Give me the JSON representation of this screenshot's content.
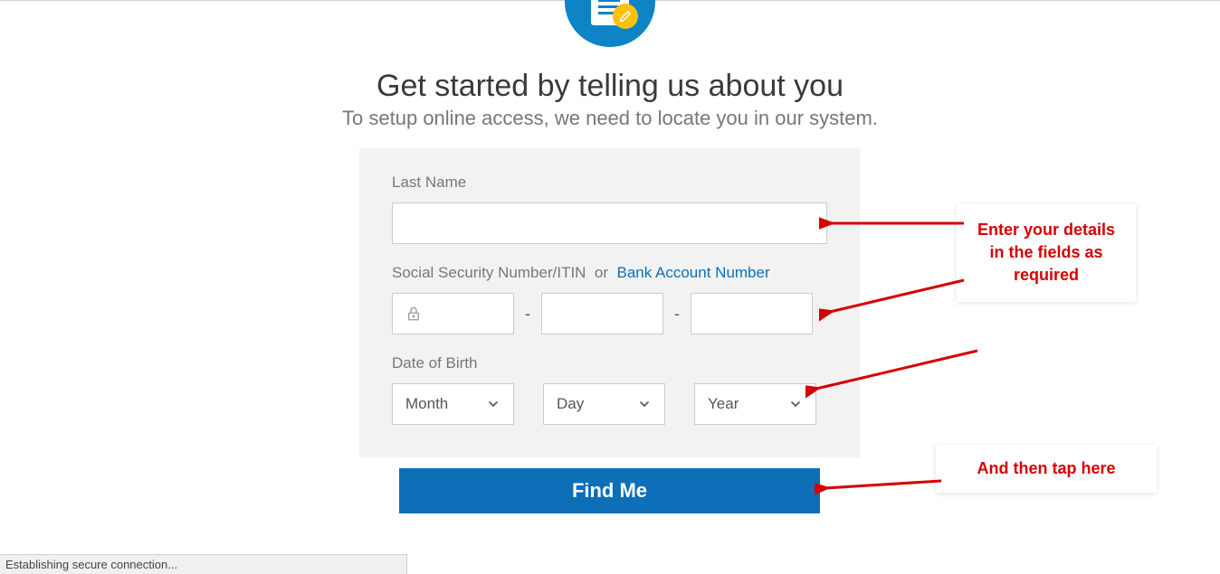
{
  "page": {
    "heading": "Get started by telling us about you",
    "subheading": "To setup online access, we need to locate you in our system."
  },
  "form": {
    "last_name_label": "Last Name",
    "last_name_value": "",
    "ssn_label": "Social Security Number/ITIN",
    "ssn_or": "or",
    "bank_link": "Bank Account Number",
    "ssn_dash": "-",
    "dob_label": "Date of Birth",
    "month_placeholder": "Month",
    "day_placeholder": "Day",
    "year_placeholder": "Year",
    "submit_label": "Find Me"
  },
  "status": {
    "text": "Establishing secure connection..."
  },
  "annotations": {
    "details": "Enter your details in the fields as required",
    "tap": "And then tap here"
  }
}
